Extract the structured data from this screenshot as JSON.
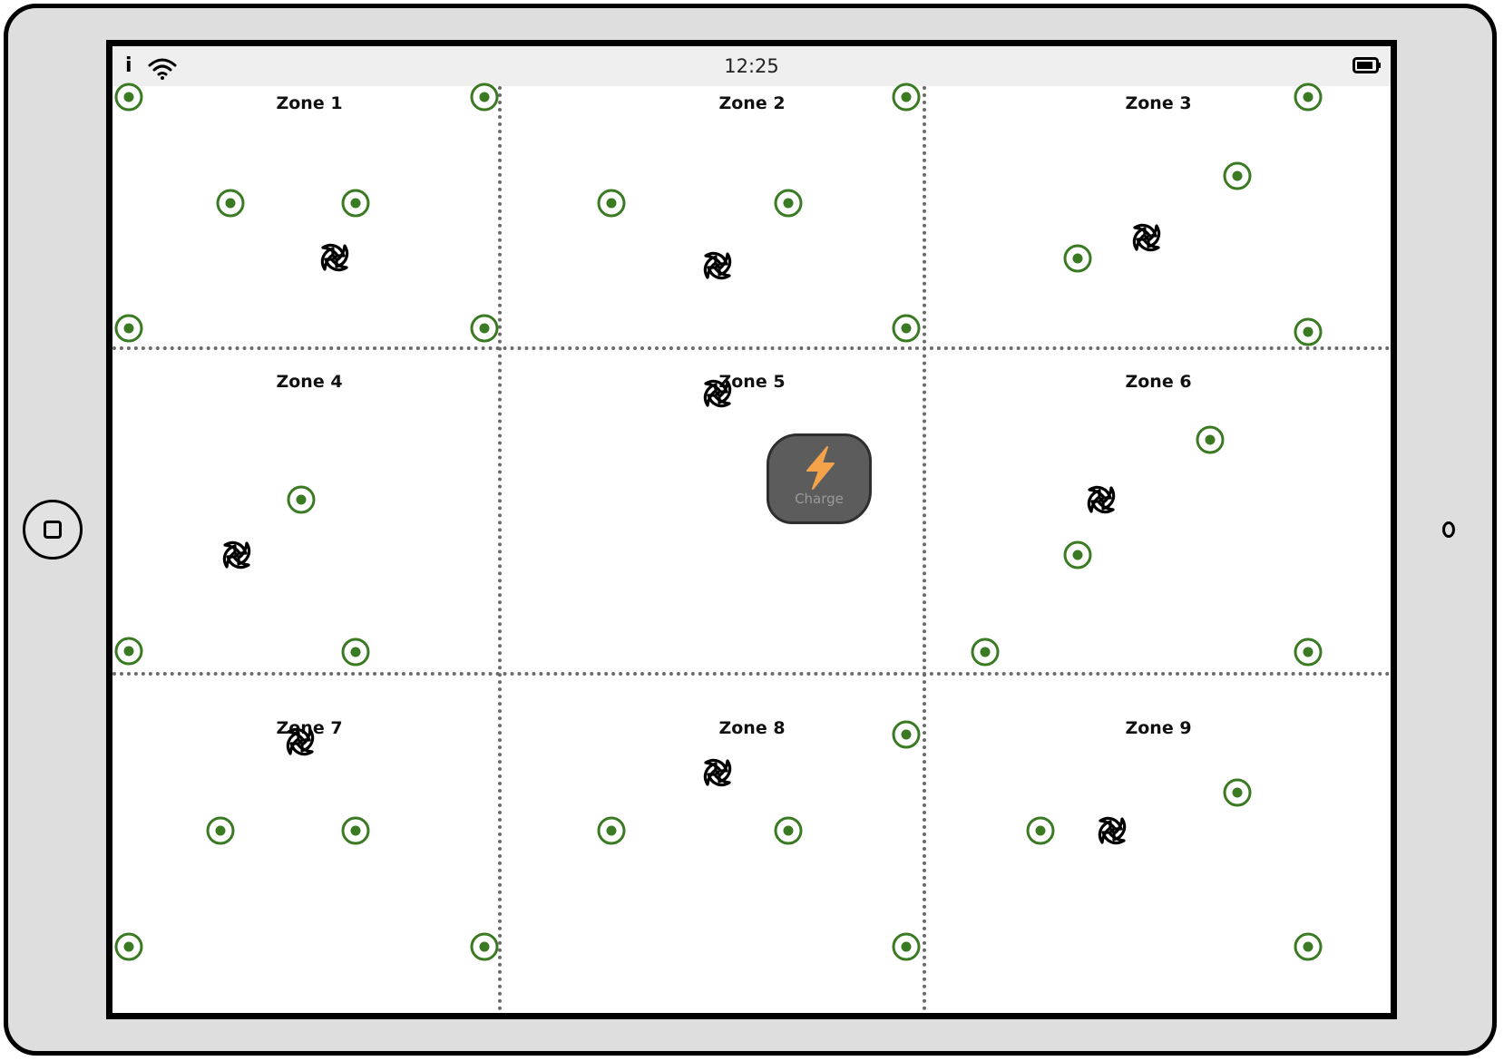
{
  "status_bar": {
    "info_glyph": "i",
    "time": "12:25",
    "wifi_icon": "wifi-icon",
    "battery_icon": "battery-icon"
  },
  "zones": [
    {
      "label": "Zone 1"
    },
    {
      "label": "Zone 2"
    },
    {
      "label": "Zone 3"
    },
    {
      "label": "Zone 4"
    },
    {
      "label": "Zone 5"
    },
    {
      "label": "Zone 6"
    },
    {
      "label": "Zone 7"
    },
    {
      "label": "Zone 8"
    },
    {
      "label": "Zone 9"
    }
  ],
  "charge_button": {
    "label": "Charge",
    "icon": "lightning-icon"
  },
  "colors": {
    "sensor": "#3a7a22",
    "divider": "#6b6b6b",
    "charge_bg": "#5c5c5c",
    "bolt": "#f5a34a",
    "device_frame": "#dedede"
  }
}
